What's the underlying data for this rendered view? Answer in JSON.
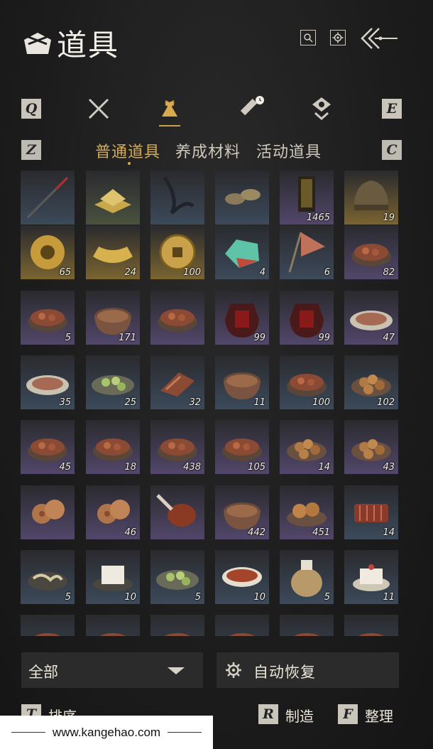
{
  "header": {
    "title": "道具"
  },
  "keys": {
    "prev_cat": "Q",
    "next_cat": "E",
    "prev_sub": "Z",
    "next_sub": "C",
    "sort": "T",
    "craft": "R",
    "organize": "F"
  },
  "sub_tabs": [
    {
      "label": "普通道具",
      "active": true
    },
    {
      "label": "养成材料",
      "active": false
    },
    {
      "label": "活动道具",
      "active": false
    }
  ],
  "items": [
    {
      "count": "",
      "bg": "#3c4a5a",
      "kind": "spear"
    },
    {
      "count": "",
      "bg": "#4a523e",
      "kind": "gold"
    },
    {
      "count": "",
      "bg": "#3c4a5a",
      "kind": "whip"
    },
    {
      "count": "",
      "bg": "#3c4a5a",
      "kind": "shoes"
    },
    {
      "count": "1465",
      "bg": "#52476a",
      "kind": "plaque"
    },
    {
      "count": "19",
      "bg": "#7a6430",
      "kind": "helmet"
    },
    {
      "count": "65",
      "bg": "#7a6430",
      "kind": "ball"
    },
    {
      "count": "24",
      "bg": "#7a6430",
      "kind": "ingot"
    },
    {
      "count": "100",
      "bg": "#7a6430",
      "kind": "coin"
    },
    {
      "count": "4",
      "bg": "#3c4a5a",
      "kind": "jade"
    },
    {
      "count": "6",
      "bg": "#3c4a5a",
      "kind": "flag"
    },
    {
      "count": "82",
      "bg": "#52476a",
      "kind": "dish"
    },
    {
      "count": "5",
      "bg": "#52476a",
      "kind": "dish"
    },
    {
      "count": "171",
      "bg": "#52476a",
      "kind": "pot"
    },
    {
      "count": "",
      "bg": "#52476a",
      "kind": "dish"
    },
    {
      "count": "99",
      "bg": "#52476a",
      "kind": "jar"
    },
    {
      "count": "99",
      "bg": "#52476a",
      "kind": "jar"
    },
    {
      "count": "47",
      "bg": "#52476a",
      "kind": "plate"
    },
    {
      "count": "35",
      "bg": "#3c4a5a",
      "kind": "plate"
    },
    {
      "count": "25",
      "bg": "#3c4a5a",
      "kind": "greens"
    },
    {
      "count": "32",
      "bg": "#3c4a5a",
      "kind": "meat"
    },
    {
      "count": "11",
      "bg": "#3c4a5a",
      "kind": "pot"
    },
    {
      "count": "100",
      "bg": "#3c4a5a",
      "kind": "dish"
    },
    {
      "count": "102",
      "bg": "#3c4a5a",
      "kind": "balls"
    },
    {
      "count": "45",
      "bg": "#52476a",
      "kind": "dish"
    },
    {
      "count": "18",
      "bg": "#52476a",
      "kind": "dish"
    },
    {
      "count": "438",
      "bg": "#52476a",
      "kind": "dish"
    },
    {
      "count": "105",
      "bg": "#52476a",
      "kind": "dish"
    },
    {
      "count": "14",
      "bg": "#52476a",
      "kind": "balls"
    },
    {
      "count": "43",
      "bg": "#52476a",
      "kind": "balls"
    },
    {
      "count": "",
      "bg": "#52476a",
      "kind": "cookies"
    },
    {
      "count": "46",
      "bg": "#52476a",
      "kind": "cookies"
    },
    {
      "count": "",
      "bg": "#52476a",
      "kind": "leg"
    },
    {
      "count": "442",
      "bg": "#52476a",
      "kind": "pot"
    },
    {
      "count": "451",
      "bg": "#52476a",
      "kind": "buns"
    },
    {
      "count": "14",
      "bg": "#3c4a5a",
      "kind": "ribs"
    },
    {
      "count": "5",
      "bg": "#3c4a5a",
      "kind": "noodles"
    },
    {
      "count": "10",
      "bg": "#3c4a5a",
      "kind": "tofu"
    },
    {
      "count": "5",
      "bg": "#3c4a5a",
      "kind": "greens"
    },
    {
      "count": "10",
      "bg": "#3c4a5a",
      "kind": "soup"
    },
    {
      "count": "5",
      "bg": "#3c4a5a",
      "kind": "sack"
    },
    {
      "count": "11",
      "bg": "#3c4a5a",
      "kind": "cake"
    },
    {
      "count": "",
      "bg": "#3c4a5a",
      "kind": "dish"
    },
    {
      "count": "",
      "bg": "#3c4a5a",
      "kind": "dish"
    },
    {
      "count": "",
      "bg": "#3c4a5a",
      "kind": "dish"
    },
    {
      "count": "",
      "bg": "#3c4a5a",
      "kind": "dish"
    },
    {
      "count": "",
      "bg": "#3c4a5a",
      "kind": "dish"
    },
    {
      "count": "",
      "bg": "#3c4a5a",
      "kind": "dish"
    }
  ],
  "footer": {
    "filter_label": "全部",
    "auto_label": "自动恢复",
    "sort_label": "排序",
    "craft_label": "制造",
    "organize_label": "整理"
  },
  "watermark": "www.kangehao.com"
}
